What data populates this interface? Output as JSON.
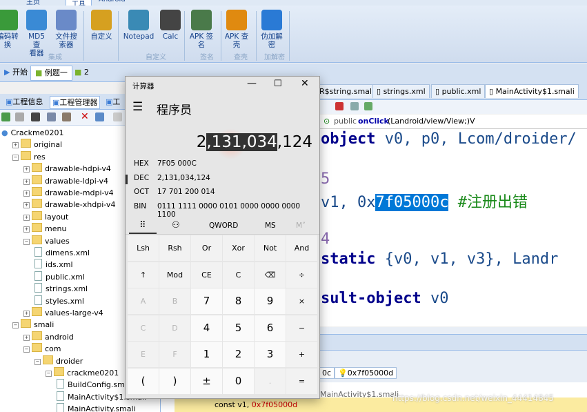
{
  "ribbon": {
    "tabs": [
      "主页",
      "工具",
      "Android"
    ],
    "buttons": [
      {
        "label": "编码转\n换",
        "icon": "convert-icon"
      },
      {
        "label": "MD5 查\n看器",
        "icon": "md5-icon"
      },
      {
        "label": "文件搜\n索器",
        "icon": "file-search-icon"
      },
      {
        "label": "自定义",
        "icon": "custom-icon"
      },
      {
        "label": "Notepad",
        "icon": "notepad-icon"
      },
      {
        "label": "Calc",
        "icon": "calculator-icon"
      },
      {
        "label": "APK 签\n名",
        "icon": "apk-sign-icon"
      },
      {
        "label": "APK 查\n壳",
        "icon": "apk-shell-icon"
      },
      {
        "label": "伪加解\n密",
        "icon": "fake-encrypt-icon"
      }
    ],
    "groups": [
      "集成",
      "自定义",
      "签名",
      "查壳",
      "加解密"
    ]
  },
  "doc_tabs": {
    "start": "开始",
    "example": "例题一",
    "second": "2"
  },
  "left_pane": {
    "tabs": [
      "工程信息",
      "工程管理器",
      "工"
    ],
    "tree": [
      {
        "label": "Crackme0201",
        "level": 0,
        "kind": "root"
      },
      {
        "label": "original",
        "level": 1,
        "kind": "folder"
      },
      {
        "label": "res",
        "level": 1,
        "kind": "folder"
      },
      {
        "label": "drawable-hdpi-v4",
        "level": 2,
        "kind": "folder"
      },
      {
        "label": "drawable-ldpi-v4",
        "level": 2,
        "kind": "folder"
      },
      {
        "label": "drawable-mdpi-v4",
        "level": 2,
        "kind": "folder"
      },
      {
        "label": "drawable-xhdpi-v4",
        "level": 2,
        "kind": "folder"
      },
      {
        "label": "layout",
        "level": 2,
        "kind": "folder"
      },
      {
        "label": "menu",
        "level": 2,
        "kind": "folder"
      },
      {
        "label": "values",
        "level": 2,
        "kind": "folder"
      },
      {
        "label": "dimens.xml",
        "level": 3,
        "kind": "file"
      },
      {
        "label": "ids.xml",
        "level": 3,
        "kind": "file"
      },
      {
        "label": "public.xml",
        "level": 3,
        "kind": "file"
      },
      {
        "label": "strings.xml",
        "level": 3,
        "kind": "file"
      },
      {
        "label": "styles.xml",
        "level": 3,
        "kind": "file"
      },
      {
        "label": "values-large-v4",
        "level": 2,
        "kind": "folder"
      },
      {
        "label": "smali",
        "level": 1,
        "kind": "folder"
      },
      {
        "label": "android",
        "level": 2,
        "kind": "folder"
      },
      {
        "label": "com",
        "level": 2,
        "kind": "folder"
      },
      {
        "label": "droider",
        "level": 3,
        "kind": "folder"
      },
      {
        "label": "crackme0201",
        "level": 4,
        "kind": "folder"
      },
      {
        "label": "BuildConfig.smali",
        "level": 5,
        "kind": "file"
      },
      {
        "label": "MainActivity$1.smali",
        "level": 5,
        "kind": "file"
      },
      {
        "label": "MainActivity.smali",
        "level": 5,
        "kind": "file"
      }
    ]
  },
  "editor": {
    "tabs": [
      "R$string.smali",
      "strings.xml",
      "public.xml",
      "MainActivity$1.smali"
    ],
    "signature_prefix": "public ",
    "signature_method": "onClick",
    "signature_rest": "(Landroid/view/View;)V",
    "lines": {
      "l1_kw": "object",
      "l1_rest": " v0, p0, Lcom/droider/",
      "l2": "5",
      "l3_pre": "v1, 0x",
      "l3_hl": "7f05000c",
      "l3_comment": "  #注册出错",
      "l4": "4",
      "l5_kw": "static",
      "l5_rest": " {v0, v1, v3}, Landr",
      "l6_kw": "sult-object",
      "l6_rest": " v0"
    },
    "bottom_tabs": [
      "0c",
      "0x7f05000d"
    ],
    "bottom_file": "MainActivity$1.smali",
    "bottom_code_pre": "const v1, ",
    "bottom_code_val": "0x7f05000d",
    "watermark": "https://blog.csdn.net/weixin_44414845"
  },
  "calculator": {
    "window_title": "计算器",
    "mode": "程序员",
    "display_pre": "2",
    "display_sel": ",131,034",
    "display_post": ",124",
    "radix": [
      {
        "name": "HEX",
        "value": "7F05 000C"
      },
      {
        "name": "DEC",
        "value": "2,131,034,124"
      },
      {
        "name": "OCT",
        "value": "17 701 200 014"
      },
      {
        "name": "BIN",
        "value": "0111 1111 0000 0101 0000 0000 0000 1100"
      }
    ],
    "word_size": "QWORD",
    "memory": "MS",
    "memory2": "M˅",
    "keys": [
      [
        "Lsh",
        "Rsh",
        "Or",
        "Xor",
        "Not",
        "And"
      ],
      [
        "↑",
        "Mod",
        "CE",
        "C",
        "⌫",
        "÷"
      ],
      [
        "A",
        "B",
        "7",
        "8",
        "9",
        "×"
      ],
      [
        "C",
        "D",
        "4",
        "5",
        "6",
        "−"
      ],
      [
        "E",
        "F",
        "1",
        "2",
        "3",
        "+"
      ],
      [
        "(",
        ")",
        "±",
        "0",
        ".",
        "="
      ]
    ]
  }
}
